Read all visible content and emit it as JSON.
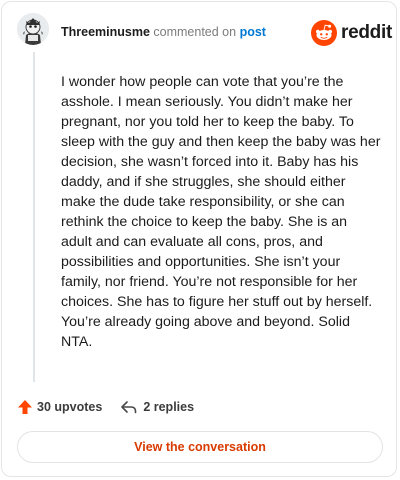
{
  "header": {
    "username": "Threeminusme",
    "action_text": "commented on",
    "post_link": "post",
    "avatar_icon": "snoo-avatar-icon"
  },
  "brand": {
    "logo_text": "reddit",
    "logo_icon": "snoo-logo-icon",
    "accent_color": "#ff4500"
  },
  "comment": {
    "body": "I wonder how people can vote that you’re the asshole. I mean seriously. You didn’t make her pregnant, nor you told her to keep the baby. To sleep with the guy and then keep the baby was her decision, she wasn’t forced into it. Baby has his daddy, and if she struggles, she should either make the dude take responsibility, or she can rethink the choice to keep the baby. She is an adult and can evaluate all cons, pros, and possibilities and opportunities. She isn’t your family, nor friend. You’re not responsible for her choices. She has to figure her stuff out by herself. You’re already going above and beyond. Solid NTA."
  },
  "actions": {
    "upvotes_label": "30 upvotes",
    "upvote_icon": "upvote-arrow-icon",
    "upvote_color": "#ff4500",
    "replies_label": "2 replies",
    "reply_icon": "reply-arrow-icon"
  },
  "footer": {
    "view_button_label": "View the conversation",
    "view_button_color": "#d93a00"
  }
}
